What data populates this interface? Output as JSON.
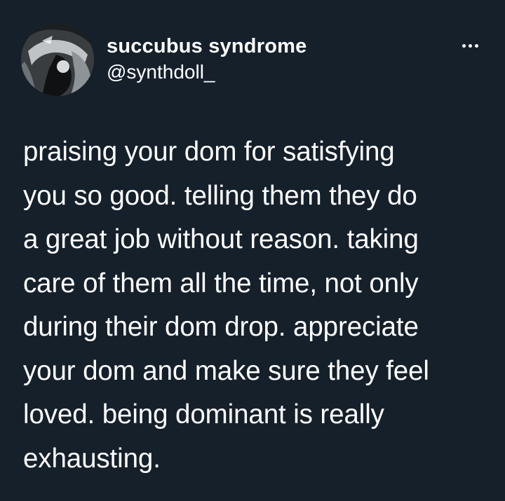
{
  "colors": {
    "background": "#15202b",
    "text": "#ffffff"
  },
  "author": {
    "display_name": "succubus syndrome",
    "handle": "@synthdoll_",
    "avatar_icon": "profile-avatar-dark-illustration"
  },
  "menu": {
    "icon": "more-options-ellipsis-icon"
  },
  "tweet": {
    "lines": [
      "praising your dom for satisfying",
      "you so good. telling them they do",
      "a great job without reason. taking",
      "care of them all the time, not only",
      "during their dom drop. appreciate",
      "your dom and make sure they feel",
      "loved. being dominant is really",
      "exhausting."
    ]
  }
}
